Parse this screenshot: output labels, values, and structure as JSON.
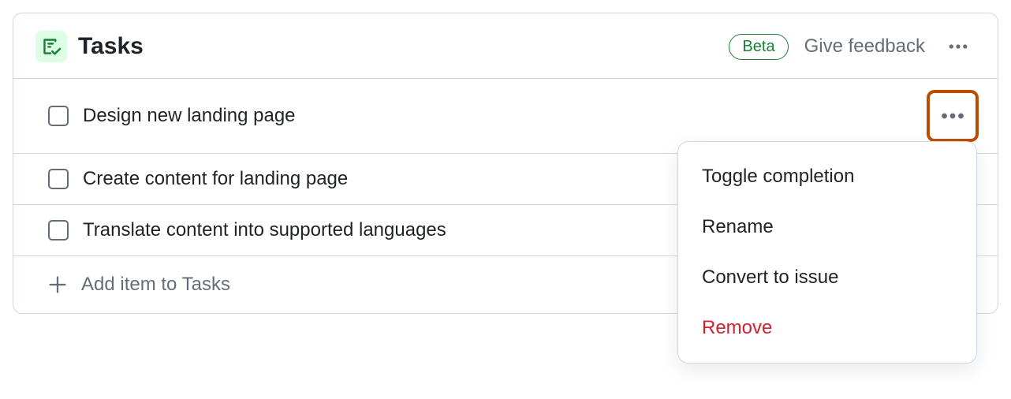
{
  "header": {
    "title": "Tasks",
    "badge": "Beta",
    "feedback": "Give feedback"
  },
  "tasks": [
    {
      "label": "Design new landing page",
      "completed": false,
      "menu_open": true
    },
    {
      "label": "Create content for landing page",
      "completed": false,
      "menu_open": false
    },
    {
      "label": "Translate content into supported languages",
      "completed": false,
      "menu_open": false
    }
  ],
  "add_item": {
    "label": "Add item to Tasks"
  },
  "dropdown": {
    "items": [
      {
        "label": "Toggle completion",
        "danger": false
      },
      {
        "label": "Rename",
        "danger": false
      },
      {
        "label": "Convert to issue",
        "danger": false
      },
      {
        "label": "Remove",
        "danger": true
      }
    ]
  }
}
